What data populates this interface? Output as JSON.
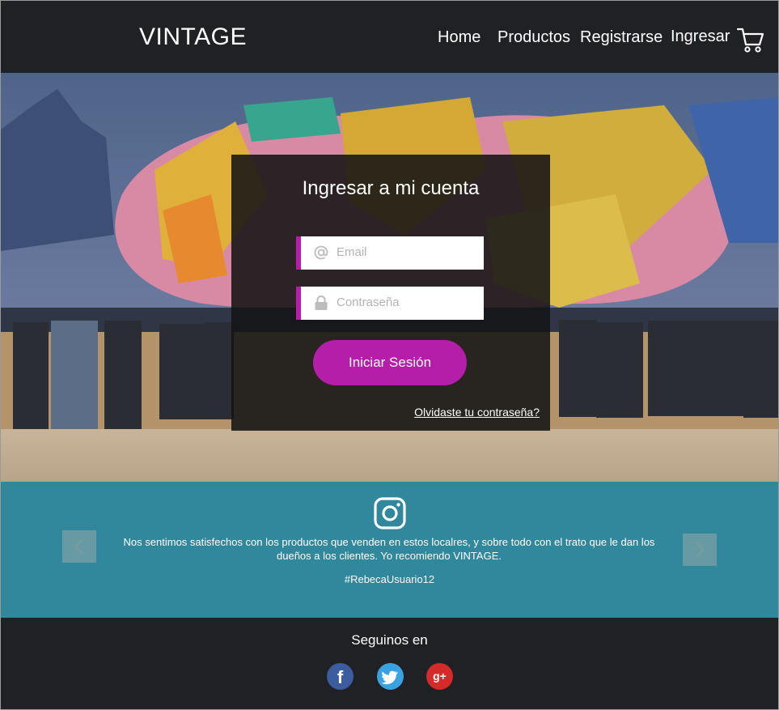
{
  "header": {
    "logo": "VINTAGE",
    "nav": {
      "home": "Home",
      "products": "Productos",
      "register": "Registrarse",
      "login": "Ingresar"
    },
    "cart_icon": "cart-icon"
  },
  "login": {
    "title": "Ingresar a mi cuenta",
    "email_placeholder": "Email",
    "password_placeholder": "Contraseña",
    "submit_label": "Iniciar Sesión",
    "forgot_link": "Olvidaste tu contraseña?",
    "email_icon": "at-icon",
    "password_icon": "lock-icon"
  },
  "testimonial": {
    "icon": "instagram-icon",
    "quote": "Nos sentimos satisfechos con los productos que venden en estos localres, y sobre todo con el trato que le dan los dueños a los clientes. Yo recomiendo VINTAGE.",
    "author": "#RebecaUsuario12"
  },
  "footer": {
    "follow_label": "Seguinos en",
    "social": [
      "facebook-icon",
      "twitter-icon",
      "google-plus-icon"
    ]
  },
  "colors": {
    "header_bg": "#202124",
    "accent": "#b51ea8",
    "testimonial_bg": "#31879b",
    "facebook": "#3b5c9e",
    "twitter": "#3aa2e0",
    "google_plus": "#d42a2a"
  }
}
